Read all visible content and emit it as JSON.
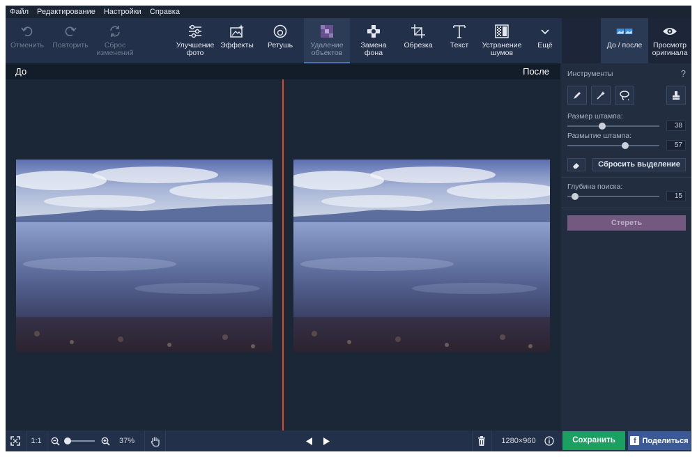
{
  "menu": [
    "Файл",
    "Редактирование",
    "Настройки",
    "Справка"
  ],
  "toolbar": {
    "undo": "Отменить",
    "redo": "Повторить",
    "reset": "Сброс\nизменений",
    "enhance": "Улучшение\nфото",
    "effects": "Эффекты",
    "retouch": "Ретушь",
    "remove_objects": "Удаление\nобъектов",
    "replace_bg": "Замена\nфона",
    "crop": "Обрезка",
    "text": "Текст",
    "denoise": "Устранение\nшумов",
    "more": "Ещё",
    "before_after": "До / после",
    "preview_original": "Просмотр\nоригинала"
  },
  "compare": {
    "before": "До",
    "after": "После"
  },
  "panel": {
    "title": "Инструменты",
    "help": "?",
    "stamp_size_label": "Размер штампа:",
    "stamp_size_value": "38",
    "stamp_blur_label": "Размытие штампа:",
    "stamp_blur_value": "57",
    "reset_selection": "Сбросить выделение",
    "search_depth_label": "Глубина поиска:",
    "search_depth_value": "15",
    "erase": "Стереть"
  },
  "bottom": {
    "actual_size": "1:1",
    "zoom": "37%",
    "resolution": "1280×960",
    "save": "Сохранить",
    "share": "Поделиться",
    "share_icon_letter": "f"
  },
  "colors": {
    "accent_divider": "#d9492a",
    "save_green": "#1aa060",
    "share_blue": "#3b5897",
    "erase_purple": "#73597f"
  }
}
